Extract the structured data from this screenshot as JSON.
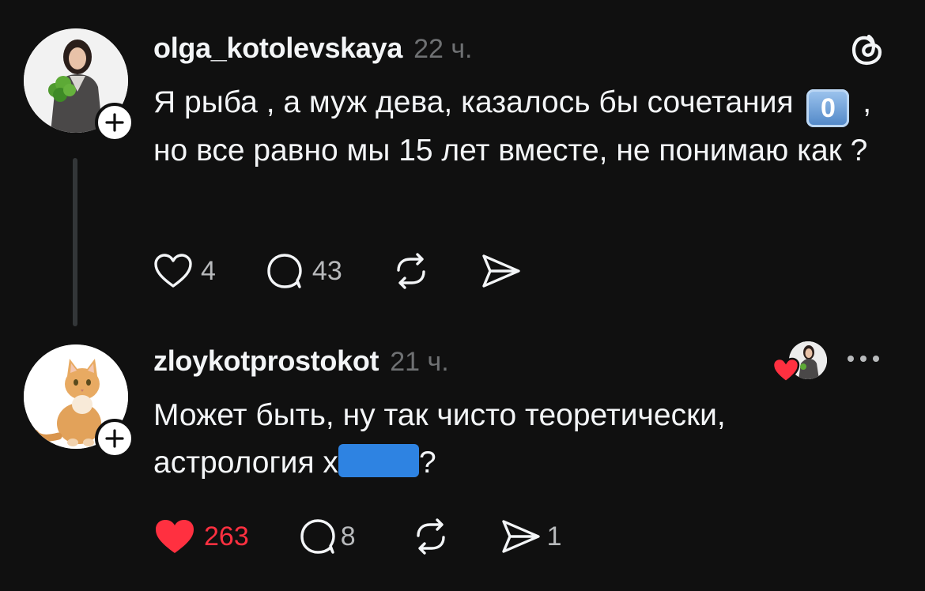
{
  "posts": [
    {
      "username": "olga_kotolevskaya",
      "time": "22 ч.",
      "text_part1": "Я рыба , а муж дева, казалось бы сочетания ",
      "emoji": "0",
      "text_part2": " , но все равно мы 15 лет вместе, не понимаю как ?",
      "likes": "4",
      "replies": "43",
      "liked": false
    },
    {
      "username": "zloykotprostokot",
      "time": "21 ч.",
      "text_part1": "Может быть, ну так чисто теоретически, астрология х",
      "text_part2": "?",
      "likes": "263",
      "replies": "8",
      "shares": "1",
      "liked": true
    }
  ],
  "colors": {
    "background": "#101010",
    "text": "#f3f5f7",
    "secondary": "#6f7173",
    "like_red": "#ff3040",
    "redaction_blue": "#2e83e2"
  },
  "icons": [
    "threads-logo-icon",
    "plus-icon",
    "heart-icon",
    "comment-icon",
    "repost-icon",
    "share-icon",
    "more-icon"
  ]
}
